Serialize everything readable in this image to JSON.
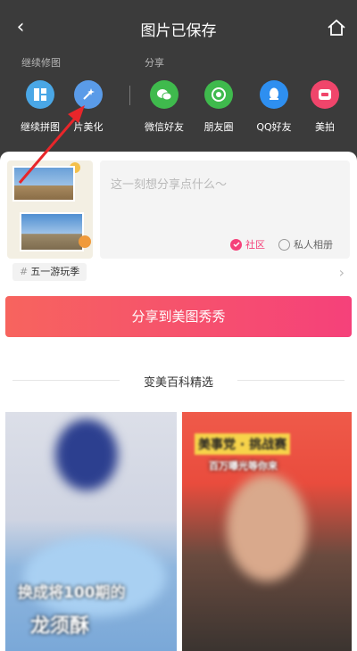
{
  "header": {
    "title": "图片已保存",
    "back_icon": "back-arrow-icon",
    "home_icon": "home-icon"
  },
  "sections": {
    "edit_label": "继续修图",
    "share_label": "分享"
  },
  "tools": [
    {
      "label": "继续拼图",
      "icon": "collage-icon",
      "color": "#4aa7e6"
    },
    {
      "label": "片美化",
      "icon": "beautify-wand-icon",
      "color": "#5a9be8"
    },
    {
      "label": "微信好友",
      "icon": "wechat-icon",
      "color": "#3fba4d"
    },
    {
      "label": "朋友圈",
      "icon": "moments-icon",
      "color": "#3fba4d"
    },
    {
      "label": "QQ好友",
      "icon": "qq-icon",
      "color": "#2e8ff0"
    },
    {
      "label": "美拍",
      "icon": "meipai-icon",
      "color": "#f0456b"
    }
  ],
  "post": {
    "placeholder": "这一刻想分享点什么～",
    "option_community": "社区",
    "option_private": "私人相册"
  },
  "topic": {
    "label": "五一游玩季",
    "hash": "#"
  },
  "share_button": "分享到美图秀秀",
  "section_title": "变美百科精选",
  "feed": [
    {
      "overlay_line1": "换成将100期的",
      "overlay_line2": "龙须酥"
    },
    {
      "overlay_line1": "美事党 · 挑战赛",
      "overlay_line2": "百万曝光等你来"
    }
  ],
  "colors": {
    "accent": "#f5417a",
    "accent_start": "#f7645e",
    "annotation_arrow": "#e8262a"
  }
}
